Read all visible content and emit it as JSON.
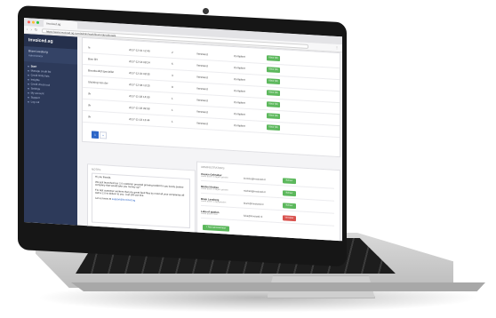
{
  "colors": {
    "sidebar": "#2d3a5a",
    "accent_green": "#5cb85c",
    "accent_red": "#d9534f",
    "link_blue": "#2d66c7"
  },
  "browser": {
    "tab_title": "Invoiced.ag",
    "url": "https://www.invoiced.ag.com/admin/workflow/orders/details",
    "nav_icons": "‹ › ↻",
    "menu_icon": "⋮"
  },
  "sidebar": {
    "brand": "Invoiced.ag",
    "user_name": "Bram Leesberg",
    "user_role": "Administrator",
    "items": [
      {
        "label": "Start",
        "active": true
      },
      {
        "label": "Manage credit list",
        "active": false
      },
      {
        "label": "Credit limits lists",
        "active": false
      },
      {
        "label": "Insights",
        "active": false
      },
      {
        "label": "Credit check tool",
        "active": false
      },
      {
        "label": "Settings",
        "active": false
      },
      {
        "label": "My account",
        "active": false
      },
      {
        "label": "Support",
        "active": false
      },
      {
        "label": "Log out",
        "active": false
      }
    ]
  },
  "table": {
    "rows": [
      {
        "name": "te",
        "date": "2017-12-01 12:40",
        "num": "2",
        "sent": "Verstuurd",
        "status": "Compleet",
        "action": "Klaar (B)"
      },
      {
        "name": "Boer BV",
        "date": "2017-12-18 08:24",
        "num": "5",
        "sent": "Verstuurd",
        "status": "Compleet",
        "action": "Klaar (B)"
      },
      {
        "name": "Bouwbedrijf specialist",
        "date": "2017-12-20 08:35",
        "num": "3",
        "sent": "Verstuurd",
        "status": "Compleet",
        "action": "Klaar (B)"
      },
      {
        "name": "Stichting Van der",
        "date": "2017-12-08 13:25",
        "num": "8",
        "sent": "Verstuurd",
        "status": "Compleet",
        "action": "Klaar (B)"
      },
      {
        "name": "dv",
        "date": "2017-11-28 14:09",
        "num": "1",
        "sent": "Verstuurd",
        "status": "Compleet",
        "action": "Klaar (B)"
      },
      {
        "name": "dv",
        "date": "2017-11-28 09:58",
        "num": "1",
        "sent": "Verstuurd",
        "status": "Compleet",
        "action": "Klaar (B)"
      },
      {
        "name": "dv",
        "date": "2017-11-23 13:44",
        "num": "1",
        "sent": "Verstuurd",
        "status": "Compleet",
        "action": "Klaar (B)"
      }
    ],
    "pager": [
      "1",
      "»"
    ]
  },
  "note": {
    "heading": "Notes",
    "greeting": "Hi you friends,",
    "p1": "We just launched our 2.0 customer proceed growing toolkit for you lovely partner company that would take you money up?",
    "p2": "For last customer workers that you great feed files by most all your companies all well a 2.0 to deliver to you. Just still use this.",
    "link_prefix": "Let us know at",
    "link": "support@invoiced.ag"
  },
  "admins": {
    "heading": "Administrators",
    "rows": [
      {
        "name": "Invoice Gebruiker",
        "sub": "Laatst actief: 3 dagen geleden",
        "email": "invoice@invoiced.nl",
        "role": "Beheer",
        "role_color": "#5cb85c"
      },
      {
        "name": "Michiel Andrea",
        "sub": "Laatst actief: 2 dagen geleden",
        "email": "michiel@invoiced.nl",
        "role": "Beheer",
        "role_color": "#5cb85c"
      },
      {
        "name": "Bram Leesberg",
        "sub": "Laatst actief: 1 dag geleden",
        "email": "bram@invoiced.nl",
        "role": "Beheer",
        "role_color": "#5cb85c"
      },
      {
        "name": "Luka of sjablon",
        "sub": "Laatst actief: nooit",
        "email": "luka@invoiced.nl",
        "role": "Verwijder",
        "role_color": "#d9534f"
      }
    ],
    "add_label": "+ Add administrator"
  }
}
